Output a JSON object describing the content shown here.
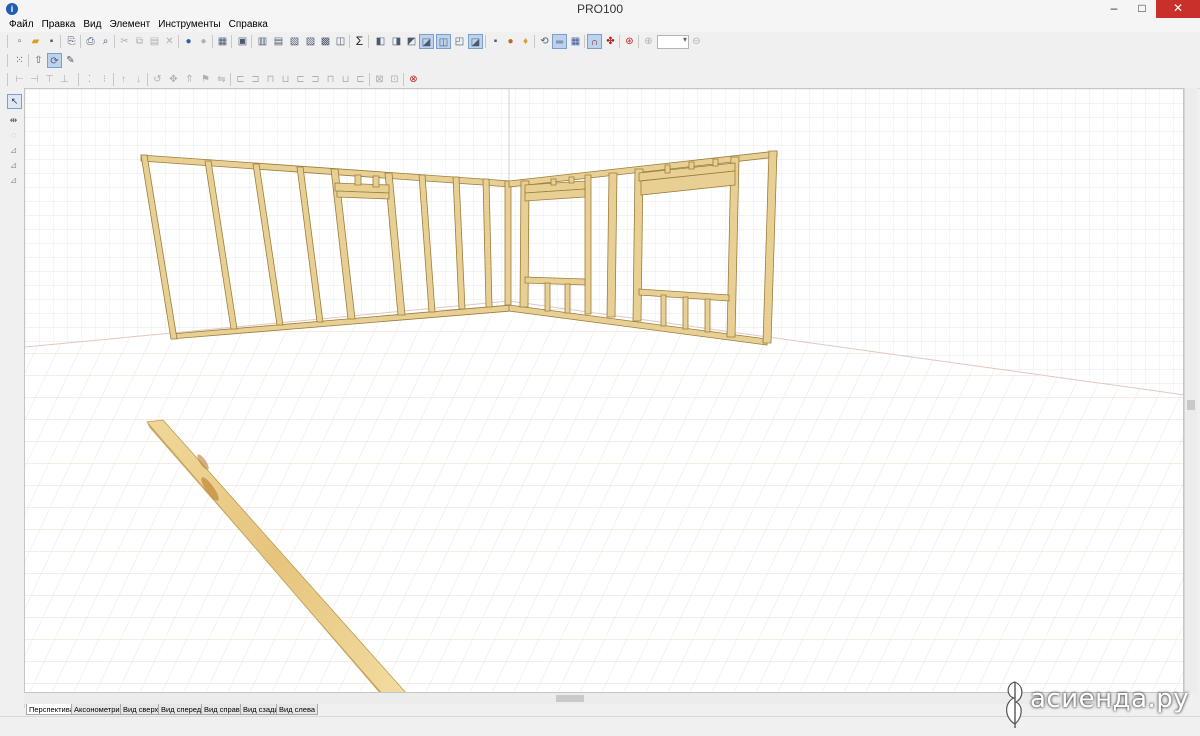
{
  "window": {
    "title": "PRO100",
    "minimize": "–",
    "maximize": "□",
    "close": "✕"
  },
  "menu": {
    "items": [
      "Файл",
      "Правка",
      "Вид",
      "Элемент",
      "Инструменты",
      "Справка"
    ]
  },
  "view_tabs": [
    {
      "label": "Перспектива",
      "active": true
    },
    {
      "label": "Аксонометрия",
      "active": false
    },
    {
      "label": "Вид сверху",
      "active": false
    },
    {
      "label": "Вид спереди",
      "active": false
    },
    {
      "label": "Вид справа",
      "active": false
    },
    {
      "label": "Вид сзади",
      "active": false
    },
    {
      "label": "Вид слева",
      "active": false
    }
  ],
  "toolbar": {
    "zoom_value": ""
  },
  "watermark": {
    "text": "асиенда.ру"
  },
  "colors": {
    "grid": "#e4e0e0",
    "floor_grid": "#f0d8d0",
    "wood": "#e8cf93",
    "wood_dark": "#b89a50",
    "close_button": "#c7302b"
  }
}
